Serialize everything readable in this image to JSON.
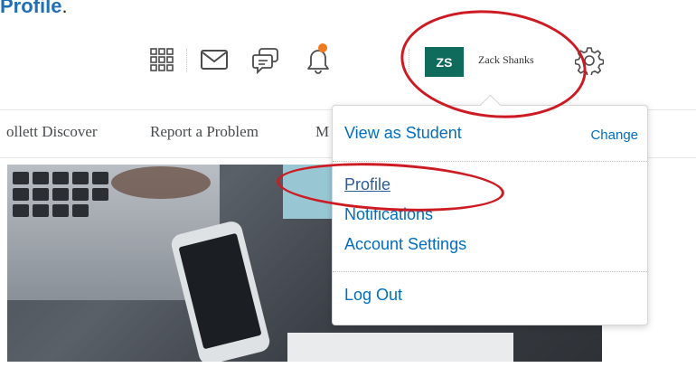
{
  "caption": {
    "text": "Profile",
    "trailing": "."
  },
  "topbar": {
    "avatar_initials": "ZS",
    "user_name": "Zack Shanks",
    "notification_dot_color": "#f27a1e",
    "avatar_color": "#0f6b5c"
  },
  "nav": {
    "items": [
      "ollett Discover",
      "Report a Problem",
      "M"
    ]
  },
  "dropdown": {
    "view_as_student": "View as Student",
    "change": "Change",
    "profile": "Profile",
    "notifications": "Notifications",
    "account_settings": "Account Settings",
    "log_out": "Log Out"
  },
  "icons": [
    "grid-icon",
    "mail-icon",
    "chat-icon",
    "bell-icon",
    "gear-icon"
  ],
  "annotation_color": "#cc1b22"
}
